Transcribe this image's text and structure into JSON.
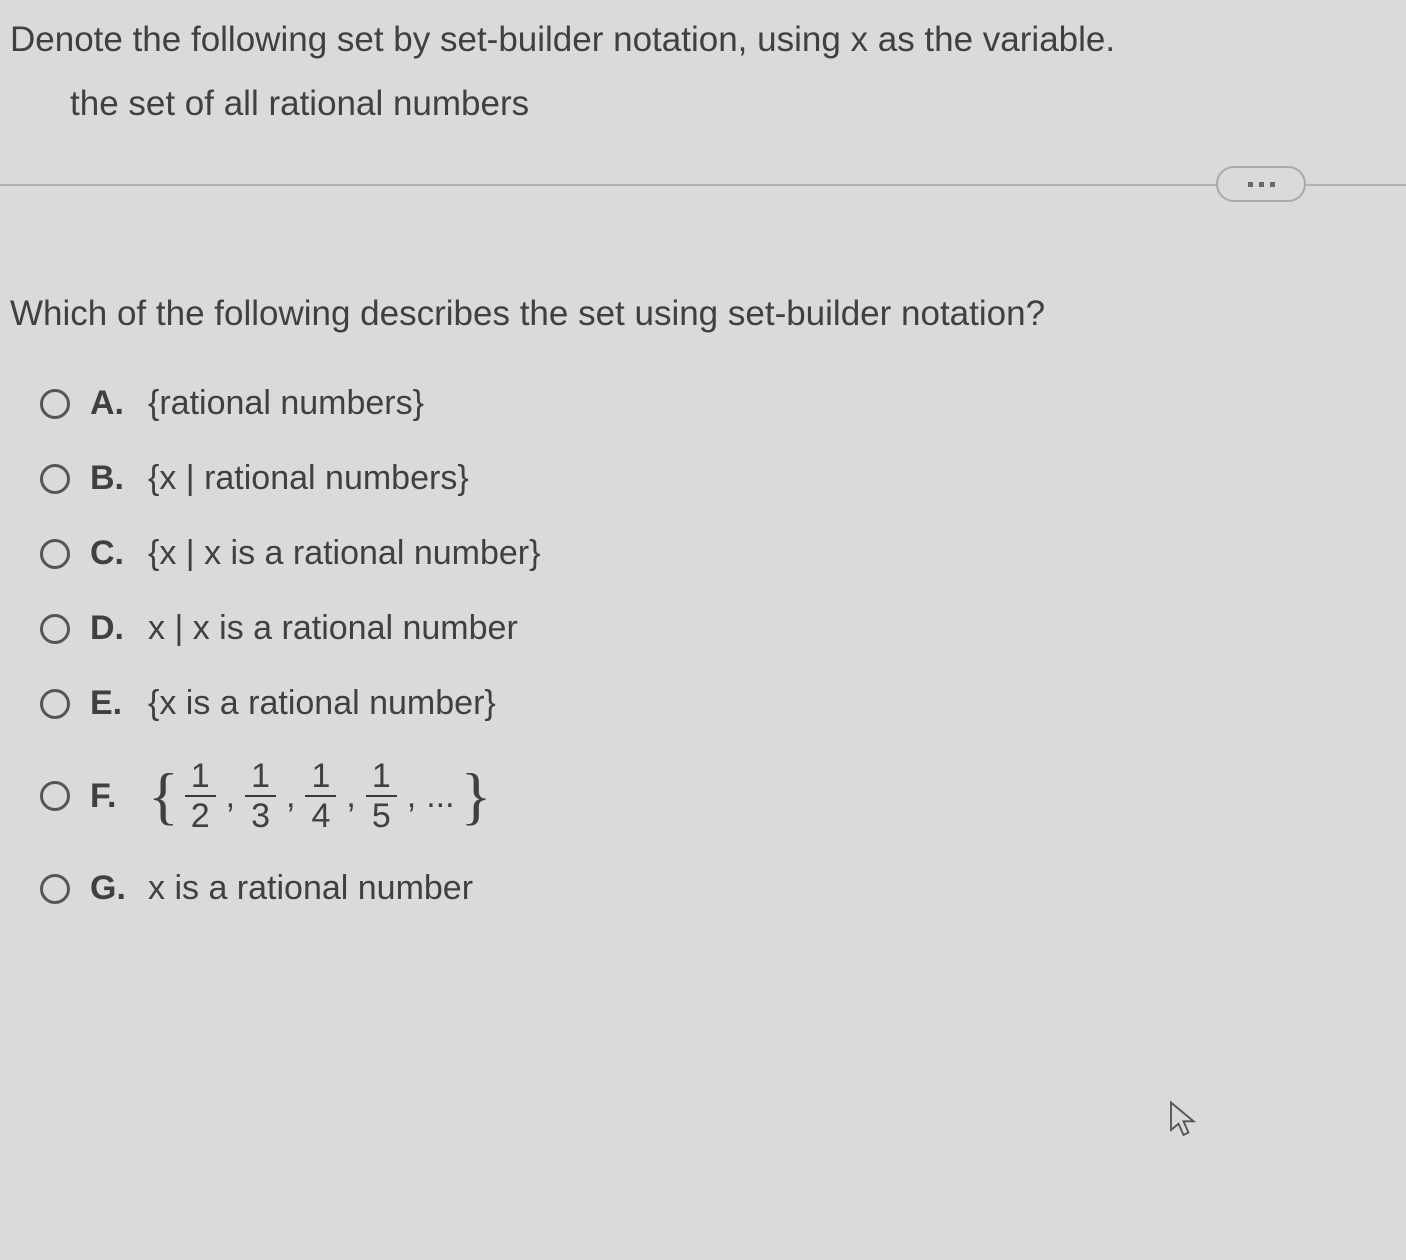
{
  "instruction": "Denote the following set by set-builder notation, using x as the variable.",
  "sub_instruction": "the set of all rational numbers",
  "question": "Which of the following describes the set using set-builder notation?",
  "choices": {
    "a": {
      "letter": "A.",
      "text": "{rational numbers}"
    },
    "b": {
      "letter": "B.",
      "text": "{x | rational numbers}"
    },
    "c": {
      "letter": "C.",
      "text": "{x | x is a rational number}"
    },
    "d": {
      "letter": "D.",
      "text": "x | x is a rational number"
    },
    "e": {
      "letter": "E.",
      "text": "{x is a rational number}"
    },
    "f": {
      "letter": "F.",
      "brace_open": "{",
      "brace_close": "}",
      "fractions": [
        {
          "num": "1",
          "den": "2"
        },
        {
          "num": "1",
          "den": "3"
        },
        {
          "num": "1",
          "den": "4"
        },
        {
          "num": "1",
          "den": "5"
        }
      ],
      "ellipsis": "..."
    },
    "g": {
      "letter": "G.",
      "text": "x is a rational number"
    }
  },
  "comma": ","
}
